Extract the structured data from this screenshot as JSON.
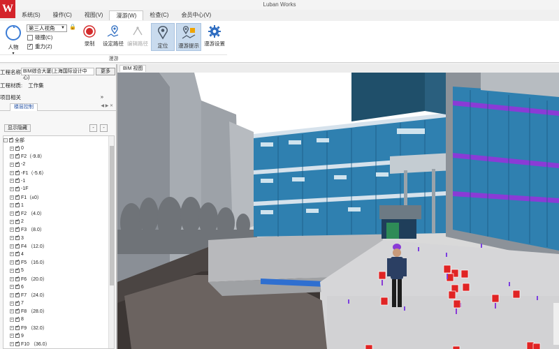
{
  "app": {
    "title": "Luban Works",
    "logo_letter": "W"
  },
  "menu": [
    {
      "label": "系统(S)",
      "active": false
    },
    {
      "label": "操作(C)",
      "active": false
    },
    {
      "label": "视图(V)",
      "active": false
    },
    {
      "label": "漫游(W)",
      "active": true
    },
    {
      "label": "检查(C)",
      "active": false
    },
    {
      "label": "会员中心(V)",
      "active": false
    }
  ],
  "ribbon": {
    "role_label": "人物",
    "view_select": "第三人视角",
    "collision_label": "碰撞(C)",
    "gravity_label": "重力(Z)",
    "record_label": "录制",
    "set_path_label": "设定路径",
    "edit_path_label": "编辑路径",
    "locate_label": "定位",
    "show_path_label": "漫游提示",
    "settings_label": "漫游设置",
    "group_label": "漫游"
  },
  "left": {
    "project_label": "工程名称:",
    "project_value": "BIM综合大厦(上海国际设计中心)",
    "more_label": "更多",
    "source_label": "工程材质:",
    "source_value": "工作集",
    "section_label": "项目相关",
    "chevron": "»",
    "tab_label": "楼层控制",
    "show_all_label": "显示隐藏",
    "tree_root": "全部",
    "floors": [
      "0",
      "F2（-9.8）",
      "-2",
      "-F1（-5.6）",
      "-1",
      "-1F",
      "F1（±0）",
      "1",
      "F2 （4.0）",
      "2",
      "F3 （8.0）",
      "3",
      "F4 （12.0）",
      "4",
      "F5 （16.0）",
      "5",
      "F6 （20.0）",
      "6",
      "F7 （24.0）",
      "7",
      "F8 （28.0）",
      "8",
      "F9 （32.0）",
      "9",
      "F10 （36.0）"
    ]
  },
  "viewport": {
    "tab_label": "BIM 视图"
  }
}
